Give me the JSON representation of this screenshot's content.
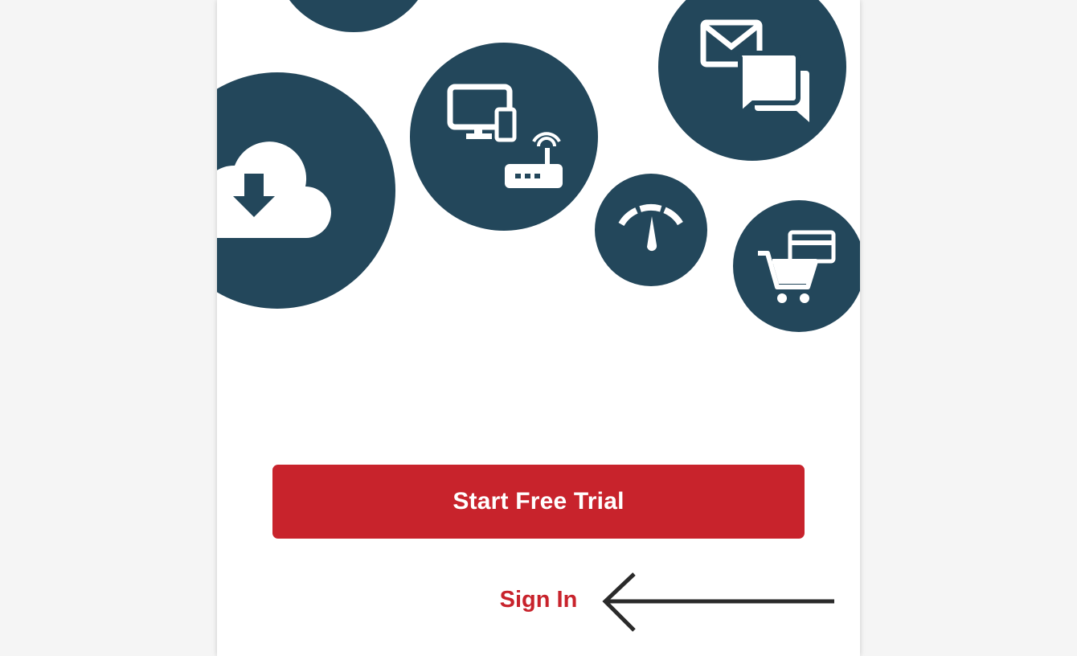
{
  "colors": {
    "circle": "#23475b",
    "brand_red": "#c8232c",
    "arrow": "#2a2a2a",
    "icon": "#ffffff"
  },
  "icons": [
    "circle-partial-top",
    "cloud-download-icon",
    "devices-wifi-icon",
    "mail-chat-icon",
    "speedometer-icon",
    "cart-card-icon",
    "arrow-left-icon"
  ],
  "actions": {
    "start_trial_label": "Start Free Trial",
    "sign_in_label": "Sign In"
  }
}
